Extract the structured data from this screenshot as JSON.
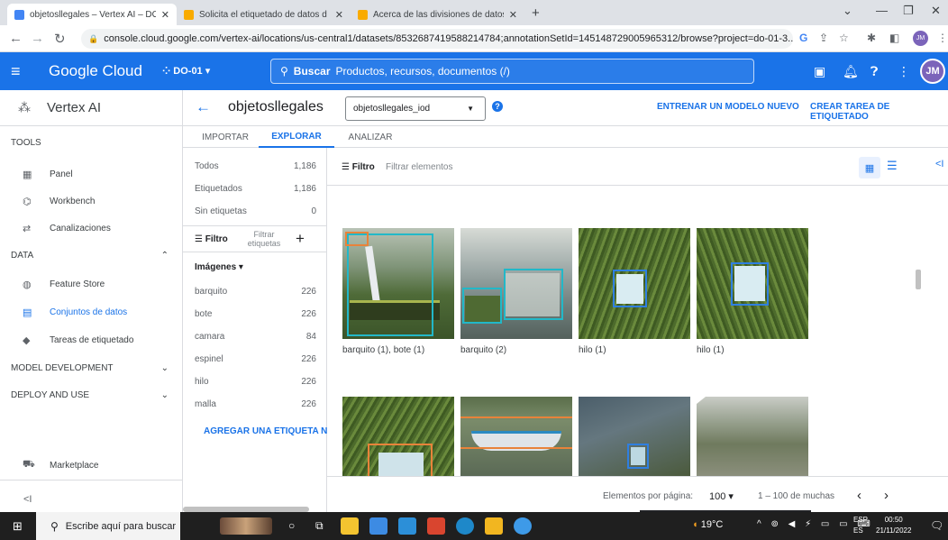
{
  "browser": {
    "tabs": [
      {
        "label": "objetosllegales – Vertex AI – DO",
        "active": true
      },
      {
        "label": "Solicita el etiquetado de datos d",
        "active": false
      },
      {
        "label": "Acerca de las divisiones de datos",
        "active": false
      }
    ],
    "new_tab": "+",
    "url": "console.cloud.google.com/vertex-ai/locations/us-central1/datasets/8532687419588214784;annotationSetId=145148729005965312/browse?project=do-01-3...",
    "profile_initials": "JM"
  },
  "header": {
    "product": "Google Cloud",
    "project": "DO-01",
    "search_button": "Buscar",
    "search_placeholder": "Productos, recursos, documentos (/)",
    "avatar": "JM"
  },
  "sidebar": {
    "product_title": "Vertex AI",
    "sections": [
      {
        "label": "TOOLS",
        "expandable": false
      },
      {
        "label": "DATA",
        "expandable": true
      },
      {
        "label": "MODEL DEVELOPMENT",
        "expandable": true
      },
      {
        "label": "DEPLOY AND USE",
        "expandable": true
      }
    ],
    "items": [
      {
        "label": "Panel",
        "icon": "dashboard-icon"
      },
      {
        "label": "Workbench",
        "icon": "workbench-icon"
      },
      {
        "label": "Canalizaciones",
        "icon": "pipelines-icon"
      },
      {
        "label": "Feature Store",
        "icon": "feature-store-icon"
      },
      {
        "label": "Conjuntos de datos",
        "icon": "datasets-icon",
        "selected": true
      },
      {
        "label": "Tareas de etiquetado",
        "icon": "labeling-icon"
      },
      {
        "label": "Marketplace",
        "icon": "marketplace-icon"
      }
    ],
    "collapse": "<I"
  },
  "dataset": {
    "title": "objetosllegales",
    "annotation_set": "objetosllegales_iod",
    "train_button": "ENTRENAR UN MODELO NUEVO",
    "label_task_button": "CREAR TAREA DE ETIQUETADO",
    "tabs": [
      "IMPORTAR",
      "EXPLORAR",
      "ANALIZAR"
    ],
    "active_tab": "EXPLORAR"
  },
  "filters": {
    "summary": [
      {
        "label": "Todos",
        "count": "1,186"
      },
      {
        "label": "Etiquetados",
        "count": "1,186"
      },
      {
        "label": "Sin etiquetas",
        "count": "0"
      }
    ],
    "filter_label": "Filtro",
    "filter_placeholder": "Filtrar etiquetas",
    "images_heading": "Imágenes",
    "labels": [
      {
        "label": "barquito",
        "count": "226"
      },
      {
        "label": "bote",
        "count": "226"
      },
      {
        "label": "camara",
        "count": "84"
      },
      {
        "label": "espinel",
        "count": "226"
      },
      {
        "label": "hilo",
        "count": "226"
      },
      {
        "label": "malla",
        "count": "226"
      }
    ],
    "add_label": "AGREGAR UNA ETIQUETA NUEVA"
  },
  "gallery": {
    "filter_label": "Filtro",
    "filter_placeholder": "Filtrar elementos",
    "captions": [
      "barquito (1), bote (1)",
      "barquito (2)",
      "hilo (1)",
      "hilo (1)"
    ]
  },
  "pager": {
    "per_page_label": "Elementos por página:",
    "per_page": "100",
    "range": "1 – 100 de muchas"
  },
  "taskbar": {
    "search_placeholder": "Escribe aquí para buscar",
    "temperature": "19°C",
    "lang_top": "ESP",
    "lang_bottom": "ES",
    "time": "00:50",
    "date": "21/11/2022"
  },
  "colors": {
    "accent": "#1a73e8",
    "bbox_blue": "#2f7fe0",
    "bbox_orange": "#e8833a",
    "bbox_teal": "#22b8c8"
  }
}
